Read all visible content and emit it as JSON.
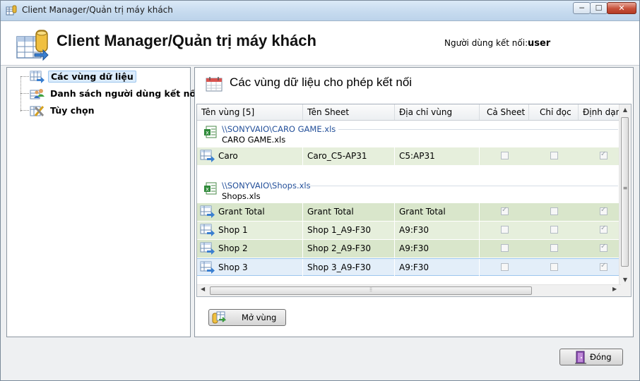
{
  "window": {
    "title": "Client Manager/Quản trị máy khách",
    "controls": {
      "minimize": "─",
      "maximize": "☐",
      "close": "✕"
    }
  },
  "header": {
    "title": "Client Manager/Quản trị máy khách",
    "connected_user_label": "Người dùng kết nối:",
    "connected_user": "user"
  },
  "sidebar": {
    "items": [
      {
        "label": "Các vùng dữ liệu",
        "icon": "data-range-icon",
        "selected": true
      },
      {
        "label": "Danh sách người dùng kết nối",
        "icon": "users-icon",
        "selected": false
      },
      {
        "label": "Tùy chọn",
        "icon": "options-tools-icon",
        "selected": false
      }
    ]
  },
  "panel": {
    "title": "Các vùng dữ liệu cho phép kết nối",
    "columns": [
      "Tên vùng [5]",
      "Tên Sheet",
      "Địa chỉ vùng",
      "Cả Sheet",
      "Chỉ đọc",
      "Định dạng"
    ],
    "groups": [
      {
        "path": "\\\\SONYVAIO\\CARO GAME.xls",
        "file": "CARO GAME.xls",
        "rows": [
          {
            "name": "Caro",
            "sheet": "Caro_C5-AP31",
            "address": "C5:AP31",
            "whole_sheet": false,
            "read_only": false,
            "format": true
          }
        ]
      },
      {
        "path": "\\\\SONYVAIO\\Shops.xls",
        "file": "Shops.xls",
        "rows": [
          {
            "name": "Grant Total",
            "sheet": "Grant Total",
            "address": "Grant Total",
            "whole_sheet": true,
            "read_only": false,
            "format": true
          },
          {
            "name": "Shop 1",
            "sheet": "Shop 1_A9-F30",
            "address": "A9:F30",
            "whole_sheet": false,
            "read_only": false,
            "format": true
          },
          {
            "name": "Shop 2",
            "sheet": "Shop 2_A9-F30",
            "address": "A9:F30",
            "whole_sheet": false,
            "read_only": false,
            "format": true
          },
          {
            "name": "Shop 3",
            "sheet": "Shop 3_A9-F30",
            "address": "A9:F30",
            "whole_sheet": false,
            "read_only": false,
            "format": true
          }
        ]
      }
    ],
    "open_button": "Mở vùng"
  },
  "footer": {
    "close_button": "Đóng"
  },
  "colors": {
    "row_even": "#e6efdc",
    "row_odd": "#d9e6cb",
    "row_selected": "#e3eef9",
    "link": "#24509a"
  }
}
